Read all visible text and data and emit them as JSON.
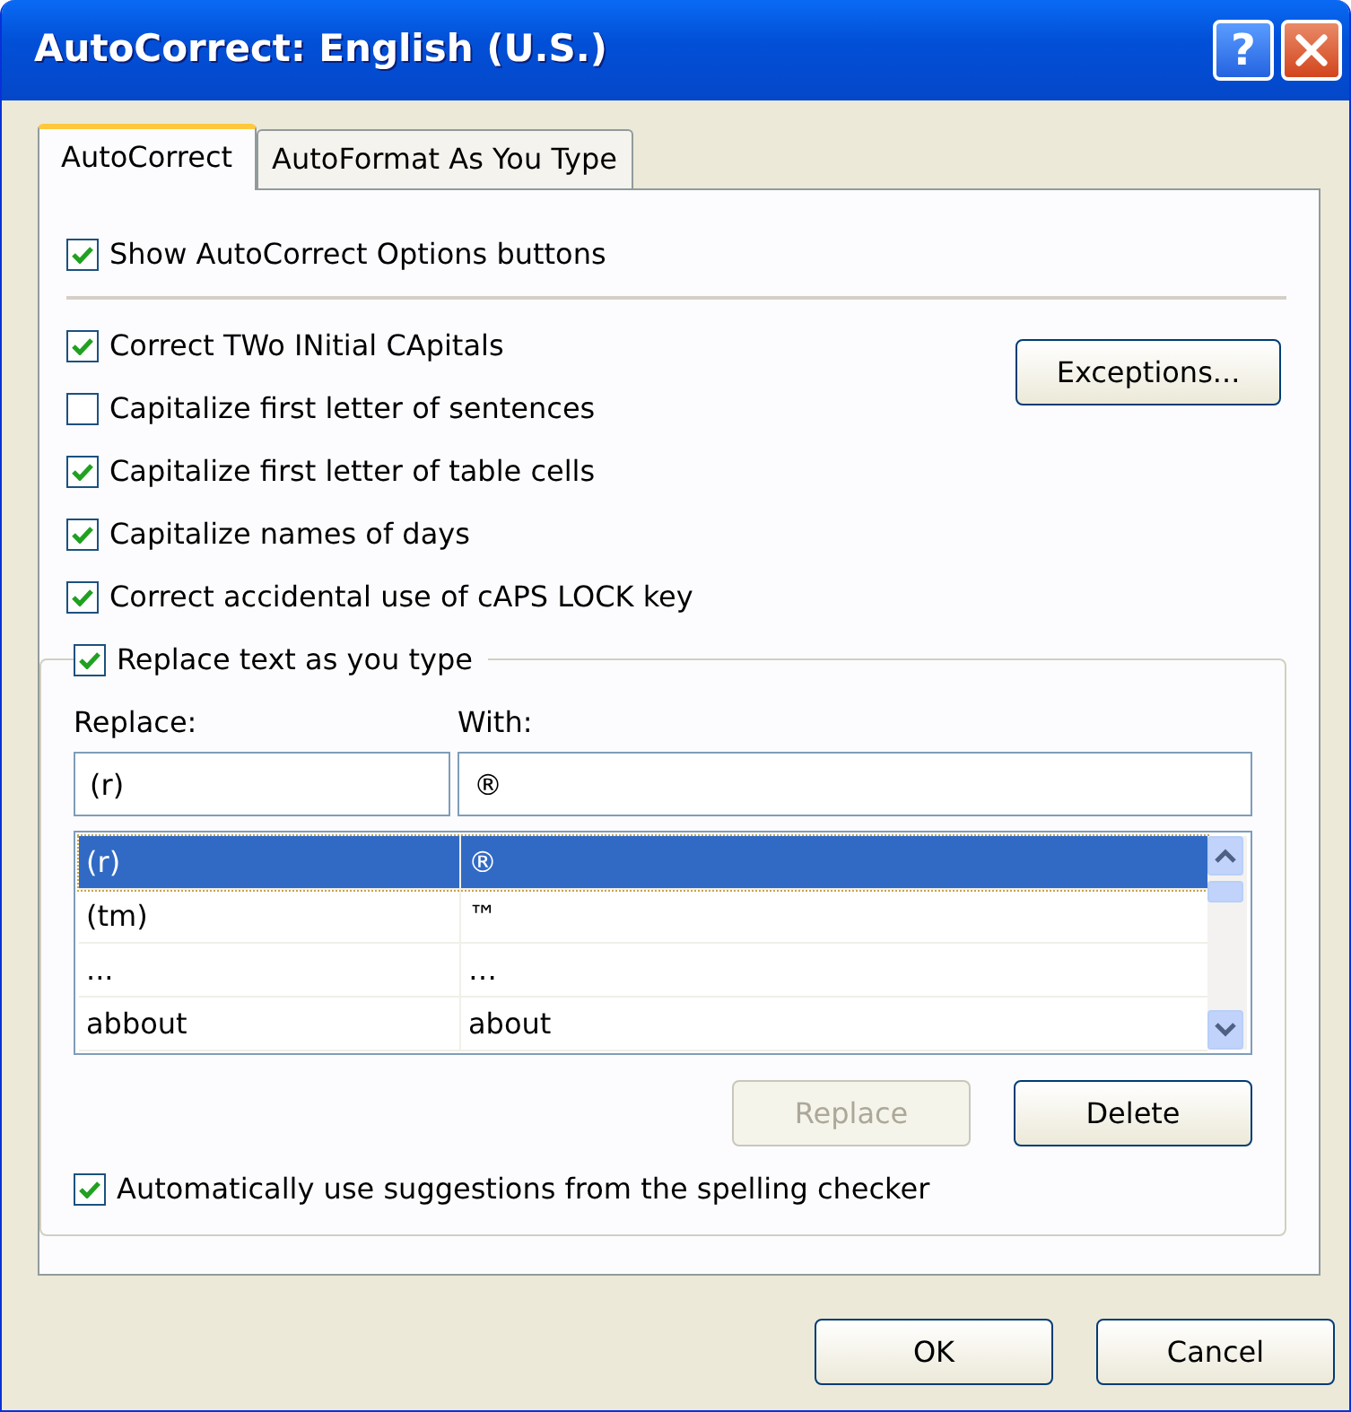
{
  "window": {
    "title": "AutoCorrect: English (U.S.)",
    "help_button": "?"
  },
  "tabs": [
    {
      "label": "AutoCorrect",
      "selected": true
    },
    {
      "label": "AutoFormat As You Type",
      "selected": false
    }
  ],
  "show_options": {
    "label": "Show AutoCorrect Options buttons",
    "checked": true
  },
  "options": [
    {
      "label": "Correct TWo INitial CApitals",
      "checked": true
    },
    {
      "label": "Capitalize first letter of sentences",
      "checked": false
    },
    {
      "label": "Capitalize first letter of table cells",
      "checked": true
    },
    {
      "label": "Capitalize names of days",
      "checked": true
    },
    {
      "label": "Correct accidental use of cAPS LOCK key",
      "checked": true
    }
  ],
  "exceptions_button": "Exceptions...",
  "replace_group": {
    "checkbox": {
      "label": "Replace text as you type",
      "checked": true
    },
    "replace_label": "Replace:",
    "with_label": "With:",
    "replace_value": "(r)",
    "with_value": "®",
    "entries": [
      {
        "replace": "(r)",
        "with": "®",
        "selected": true
      },
      {
        "replace": "(tm)",
        "with": "™",
        "selected": false
      },
      {
        "replace": "...",
        "with": "…",
        "selected": false
      },
      {
        "replace": "abbout",
        "with": "about",
        "selected": false
      }
    ],
    "buttons": [
      {
        "label": "Replace",
        "disabled": true
      },
      {
        "label": "Delete",
        "disabled": false
      }
    ],
    "suggestions": {
      "label": "Automatically use suggestions from the spelling checker",
      "checked": true
    }
  },
  "buttons": [
    "OK",
    "Cancel"
  ]
}
